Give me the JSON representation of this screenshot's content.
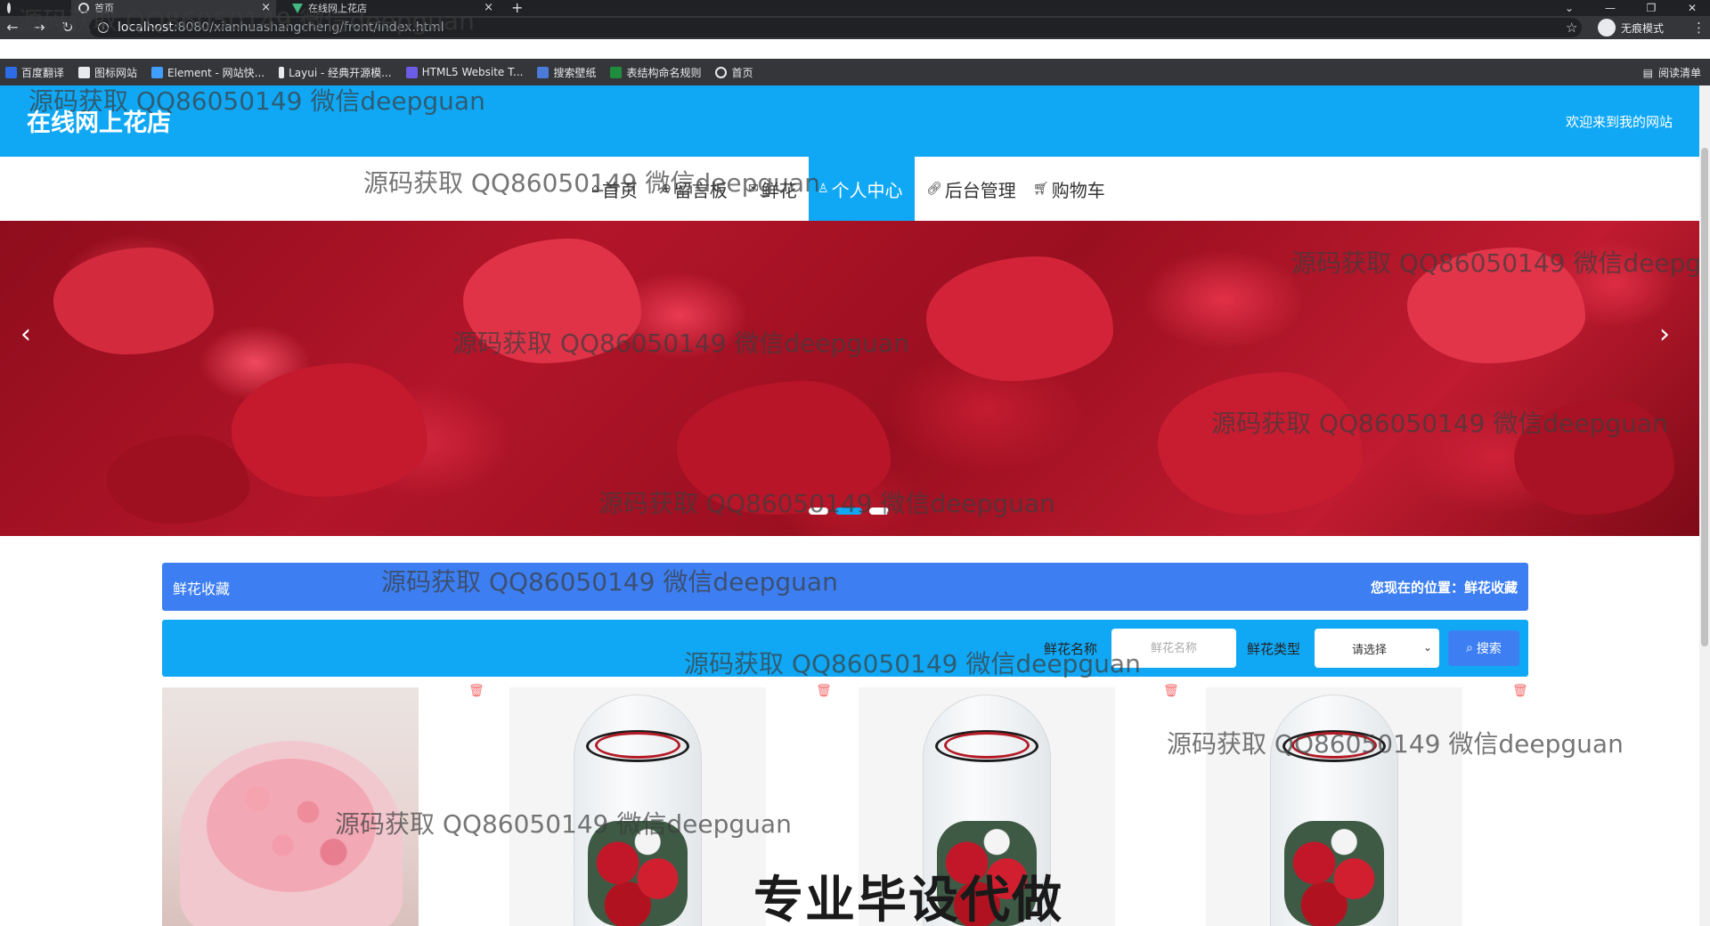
{
  "browser": {
    "tabs": [
      {
        "label": ""
      },
      {
        "label": "首页"
      },
      {
        "label": "在线网上花店"
      }
    ],
    "url_host": "localhost",
    "url_path": ":8080/xianhuashangcheng/front/index.html",
    "incognito_label": "无痕模式",
    "bookmarks": [
      "百度翻译",
      "图标网站",
      "Element - 网站快...",
      "Layui - 经典开源模...",
      "HTML5 Website T...",
      "搜索壁纸",
      "表结构命名规则",
      "首页"
    ],
    "reading_list": "阅读清单"
  },
  "header": {
    "title": "在线网上花店",
    "welcome": "欢迎来到我的网站"
  },
  "nav": {
    "home": "首页",
    "board": "留言板",
    "flowers": "鲜花",
    "profile": "个人中心",
    "admin": "后台管理",
    "cart": "购物车"
  },
  "section": {
    "title": "鲜花收藏",
    "breadcrumb": "您现在的位置：鲜花收藏"
  },
  "search": {
    "name_label": "鲜花名称",
    "name_placeholder": "鲜花名称",
    "type_label": "鲜花类型",
    "type_value": "请选择",
    "button": "搜索"
  },
  "watermarks": {
    "text": "源码获取 QQ86050149 微信deepguan",
    "big": "专业毕设代做"
  },
  "colors": {
    "header_blue": "#10a8f5",
    "section_blue": "#3d7ff2",
    "delete_red": "#f56c6c"
  }
}
